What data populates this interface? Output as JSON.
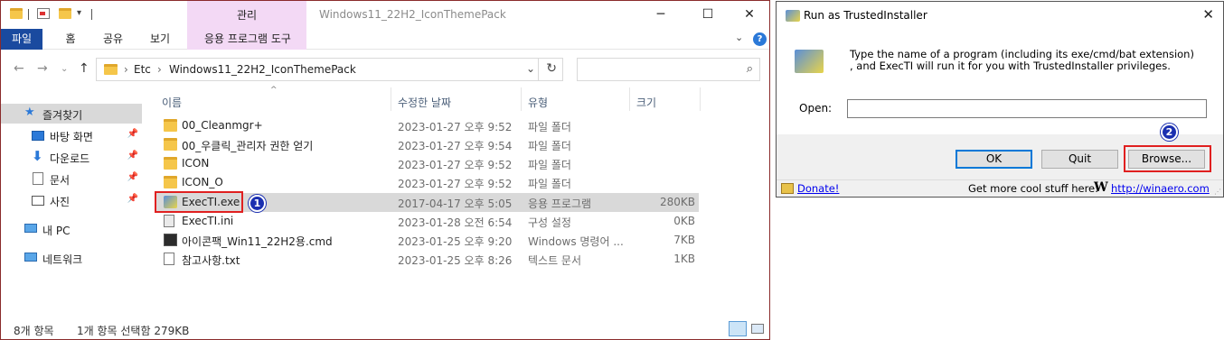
{
  "explorer": {
    "window_title": "Windows11_22H2_IconThemePack",
    "manage_tab": "관리",
    "ribbon_tabs": [
      "파일",
      "홈",
      "공유",
      "보기",
      "응용 프로그램 도구"
    ],
    "address": {
      "segments": [
        "Etc",
        "Windows11_22H2_IconThemePack"
      ]
    },
    "sidebar": [
      {
        "label": "즐겨찾기",
        "icon": "star-icon",
        "pinned": false,
        "active": true
      },
      {
        "label": "바탕 화면",
        "icon": "desktop-icon",
        "pinned": true
      },
      {
        "label": "다운로드",
        "icon": "download-icon",
        "pinned": true
      },
      {
        "label": "문서",
        "icon": "documents-icon",
        "pinned": true
      },
      {
        "label": "사진",
        "icon": "pictures-icon",
        "pinned": true
      },
      {
        "label": "내 PC",
        "icon": "computer-icon",
        "pinned": false
      },
      {
        "label": "네트워크",
        "icon": "network-icon",
        "pinned": false
      }
    ],
    "columns": [
      "이름",
      "수정한 날짜",
      "유형",
      "크기"
    ],
    "files": [
      {
        "name": "00_Cleanmgr+",
        "date": "2023-01-27 오후 9:52",
        "type": "파일 폴더",
        "size": "",
        "icon": "folder-icon"
      },
      {
        "name": "00_우클릭_관리자 권한 얻기",
        "date": "2023-01-27 오후 9:54",
        "type": "파일 폴더",
        "size": "",
        "icon": "folder-icon"
      },
      {
        "name": "ICON",
        "date": "2023-01-27 오후 9:52",
        "type": "파일 폴더",
        "size": "",
        "icon": "folder-icon"
      },
      {
        "name": "ICON_O",
        "date": "2023-01-27 오후 9:52",
        "type": "파일 폴더",
        "size": "",
        "icon": "folder-icon"
      },
      {
        "name": "ExecTI.exe",
        "date": "2017-04-17 오후 5:05",
        "type": "응용 프로그램",
        "size": "280KB",
        "icon": "exe-icon",
        "selected": true
      },
      {
        "name": "ExecTI.ini",
        "date": "2023-01-28 오전 6:54",
        "type": "구성 설정",
        "size": "0KB",
        "icon": "settings-file-icon"
      },
      {
        "name": "아이콘팩_Win11_22H2용.cmd",
        "date": "2023-01-25 오후 9:20",
        "type": "Windows 명령어 ...",
        "size": "7KB",
        "icon": "cmd-file-icon"
      },
      {
        "name": "참고사항.txt",
        "date": "2023-01-25 오후 8:26",
        "type": "텍스트 문서",
        "size": "1KB",
        "icon": "text-file-icon"
      }
    ],
    "status": {
      "count": "8개 항목",
      "selection": "1개 항목 선택함 279KB"
    },
    "badge1": "1"
  },
  "dialog": {
    "title": "Run as TrustedInstaller",
    "message_line1": "Type the name of a program (including its exe/cmd/bat extension)",
    "message_line2": ", and ExecTI will run it for you with TrustedInstaller privileges.",
    "open_label": "Open:",
    "open_value": "",
    "buttons": {
      "ok": "OK",
      "quit": "Quit",
      "browse": "Browse..."
    },
    "donate": "Donate!",
    "more_text": "Get more cool stuff here:",
    "w_logo": "W",
    "winaero_link": "http://winaero.com",
    "badge2": "2"
  },
  "colors": {
    "file_tab": "#1a4a9f",
    "manage_tab": "#f3d9f5",
    "highlight": "#e02020",
    "badge": "#1a2fb0"
  }
}
